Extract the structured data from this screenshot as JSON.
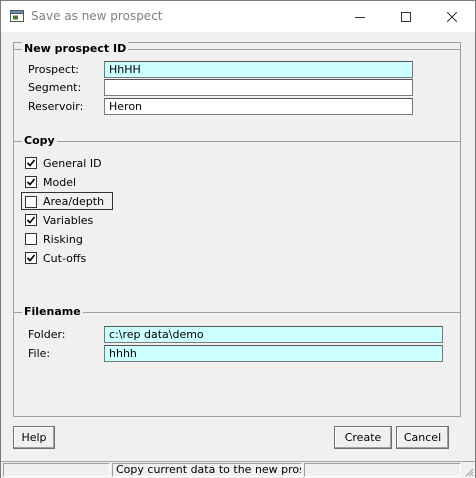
{
  "window": {
    "title": "Save as new prospect"
  },
  "new_prospect_id": {
    "title": "New prospect ID",
    "prospect_label": "Prospect:",
    "prospect_value": "HhHH",
    "segment_label": "Segment:",
    "segment_value": "",
    "reservoir_label": "Reservoir:",
    "reservoir_value": "Heron"
  },
  "copy": {
    "title": "Copy",
    "items": [
      {
        "label": "General ID",
        "checked": true
      },
      {
        "label": "Model",
        "checked": true
      },
      {
        "label": "Area/depth",
        "checked": false
      },
      {
        "label": "Variables",
        "checked": true
      },
      {
        "label": "Risking",
        "checked": false
      },
      {
        "label": "Cut-offs",
        "checked": true
      }
    ]
  },
  "filename": {
    "title": "Filename",
    "folder_label": "Folder:",
    "folder_value": "c:\\rep data\\demo",
    "file_label": "File:",
    "file_value": "hhhh"
  },
  "buttons": {
    "help": "Help",
    "create": "Create",
    "cancel": "Cancel"
  },
  "statusbar": {
    "left": "",
    "message": "Copy current data to the new prosp",
    "right": ""
  },
  "colors": {
    "field_highlight": "#ccffff",
    "chrome": "#f0f0f0"
  }
}
